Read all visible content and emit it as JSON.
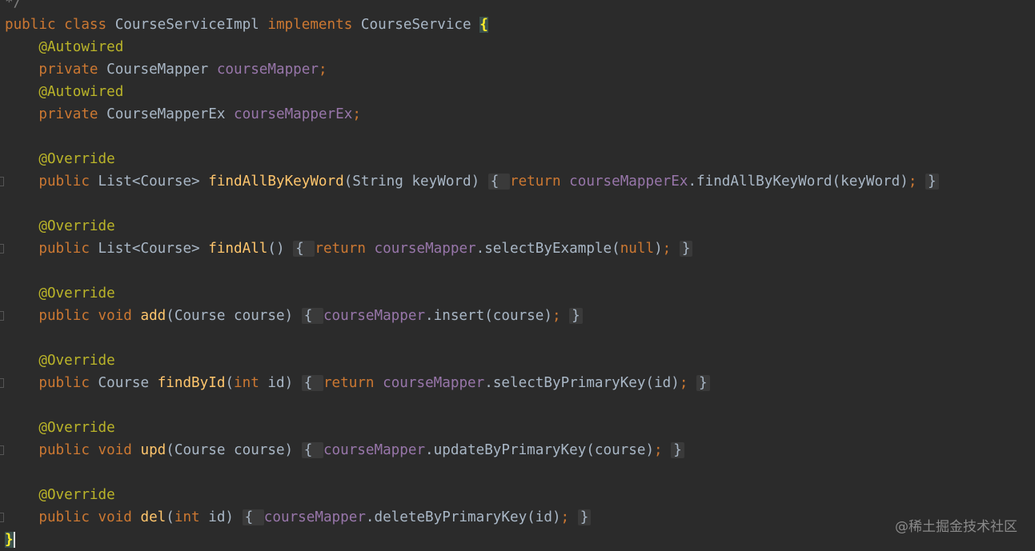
{
  "editor": {
    "theme_background": "#2b2b2b",
    "lines": [
      {
        "row": 0,
        "fold_gutter": false,
        "tokens": [
          {
            "t": "*/",
            "c": "c"
          }
        ]
      },
      {
        "row": 1,
        "fold_gutter": false,
        "tokens": [
          {
            "t": "public class ",
            "c": "k"
          },
          {
            "t": "CourseServiceImpl ",
            "c": "t"
          },
          {
            "t": "implements ",
            "c": "k"
          },
          {
            "t": "CourseService ",
            "c": "t"
          },
          {
            "t": "{",
            "c": "brace-hl"
          }
        ]
      },
      {
        "row": 2,
        "fold_gutter": false,
        "tokens": [
          {
            "t": "    ",
            "c": "t"
          },
          {
            "t": "@Autowired",
            "c": "a"
          }
        ]
      },
      {
        "row": 3,
        "fold_gutter": false,
        "tokens": [
          {
            "t": "    ",
            "c": "t"
          },
          {
            "t": "private ",
            "c": "k"
          },
          {
            "t": "CourseMapper ",
            "c": "t"
          },
          {
            "t": "courseMapper",
            "c": "f"
          },
          {
            "t": ";",
            "c": "s"
          }
        ]
      },
      {
        "row": 4,
        "fold_gutter": false,
        "tokens": [
          {
            "t": "    ",
            "c": "t"
          },
          {
            "t": "@Autowired",
            "c": "a"
          }
        ]
      },
      {
        "row": 5,
        "fold_gutter": false,
        "tokens": [
          {
            "t": "    ",
            "c": "t"
          },
          {
            "t": "private ",
            "c": "k"
          },
          {
            "t": "CourseMapperEx ",
            "c": "t"
          },
          {
            "t": "courseMapperEx",
            "c": "f"
          },
          {
            "t": ";",
            "c": "s"
          }
        ]
      },
      {
        "row": 7,
        "fold_gutter": false,
        "tokens": [
          {
            "t": "    ",
            "c": "t"
          },
          {
            "t": "@Override",
            "c": "a"
          }
        ]
      },
      {
        "row": 8,
        "fold_gutter": true,
        "tokens": [
          {
            "t": "    ",
            "c": "t"
          },
          {
            "t": "public ",
            "c": "k"
          },
          {
            "t": "List<Course> ",
            "c": "t"
          },
          {
            "t": "findAllByKeyWord",
            "c": "m"
          },
          {
            "t": "(String keyWord) ",
            "c": "t"
          },
          {
            "t": "{ ",
            "c": "fold"
          },
          {
            "t": "return ",
            "c": "k"
          },
          {
            "t": "courseMapperEx",
            "c": "f"
          },
          {
            "t": ".findAllByKeyWord(keyWord)",
            "c": "t"
          },
          {
            "t": ";",
            "c": "s"
          },
          {
            "t": " ",
            "c": "t"
          },
          {
            "t": "}",
            "c": "fold"
          }
        ]
      },
      {
        "row": 10,
        "fold_gutter": false,
        "tokens": [
          {
            "t": "    ",
            "c": "t"
          },
          {
            "t": "@Override",
            "c": "a"
          }
        ]
      },
      {
        "row": 11,
        "fold_gutter": true,
        "tokens": [
          {
            "t": "    ",
            "c": "t"
          },
          {
            "t": "public ",
            "c": "k"
          },
          {
            "t": "List<Course> ",
            "c": "t"
          },
          {
            "t": "findAll",
            "c": "m"
          },
          {
            "t": "() ",
            "c": "t"
          },
          {
            "t": "{ ",
            "c": "fold"
          },
          {
            "t": "return ",
            "c": "k"
          },
          {
            "t": "courseMapper",
            "c": "f"
          },
          {
            "t": ".selectByExample(",
            "c": "t"
          },
          {
            "t": "null",
            "c": "k"
          },
          {
            "t": ")",
            "c": "t"
          },
          {
            "t": ";",
            "c": "s"
          },
          {
            "t": " ",
            "c": "t"
          },
          {
            "t": "}",
            "c": "fold"
          }
        ]
      },
      {
        "row": 13,
        "fold_gutter": false,
        "tokens": [
          {
            "t": "    ",
            "c": "t"
          },
          {
            "t": "@Override",
            "c": "a"
          }
        ]
      },
      {
        "row": 14,
        "fold_gutter": true,
        "tokens": [
          {
            "t": "    ",
            "c": "t"
          },
          {
            "t": "public void ",
            "c": "k"
          },
          {
            "t": "add",
            "c": "m"
          },
          {
            "t": "(Course course) ",
            "c": "t"
          },
          {
            "t": "{ ",
            "c": "fold"
          },
          {
            "t": "courseMapper",
            "c": "f"
          },
          {
            "t": ".insert(course)",
            "c": "t"
          },
          {
            "t": ";",
            "c": "s"
          },
          {
            "t": " ",
            "c": "t"
          },
          {
            "t": "}",
            "c": "fold"
          }
        ]
      },
      {
        "row": 16,
        "fold_gutter": false,
        "tokens": [
          {
            "t": "    ",
            "c": "t"
          },
          {
            "t": "@Override",
            "c": "a"
          }
        ]
      },
      {
        "row": 17,
        "fold_gutter": true,
        "tokens": [
          {
            "t": "    ",
            "c": "t"
          },
          {
            "t": "public ",
            "c": "k"
          },
          {
            "t": "Course ",
            "c": "t"
          },
          {
            "t": "findById",
            "c": "m"
          },
          {
            "t": "(",
            "c": "t"
          },
          {
            "t": "int ",
            "c": "k"
          },
          {
            "t": "id) ",
            "c": "t"
          },
          {
            "t": "{ ",
            "c": "fold"
          },
          {
            "t": "return ",
            "c": "k"
          },
          {
            "t": "courseMapper",
            "c": "f"
          },
          {
            "t": ".selectByPrimaryKey(id)",
            "c": "t"
          },
          {
            "t": ";",
            "c": "s"
          },
          {
            "t": " ",
            "c": "t"
          },
          {
            "t": "}",
            "c": "fold"
          }
        ]
      },
      {
        "row": 19,
        "fold_gutter": false,
        "tokens": [
          {
            "t": "    ",
            "c": "t"
          },
          {
            "t": "@Override",
            "c": "a"
          }
        ]
      },
      {
        "row": 20,
        "fold_gutter": true,
        "tokens": [
          {
            "t": "    ",
            "c": "t"
          },
          {
            "t": "public void ",
            "c": "k"
          },
          {
            "t": "upd",
            "c": "m"
          },
          {
            "t": "(Course course) ",
            "c": "t"
          },
          {
            "t": "{ ",
            "c": "fold"
          },
          {
            "t": "courseMapper",
            "c": "f"
          },
          {
            "t": ".updateByPrimaryKey(course)",
            "c": "t"
          },
          {
            "t": ";",
            "c": "s"
          },
          {
            "t": " ",
            "c": "t"
          },
          {
            "t": "}",
            "c": "fold"
          }
        ]
      },
      {
        "row": 22,
        "fold_gutter": false,
        "tokens": [
          {
            "t": "    ",
            "c": "t"
          },
          {
            "t": "@Override",
            "c": "a"
          }
        ]
      },
      {
        "row": 23,
        "fold_gutter": true,
        "tokens": [
          {
            "t": "    ",
            "c": "t"
          },
          {
            "t": "public void ",
            "c": "k"
          },
          {
            "t": "del",
            "c": "m"
          },
          {
            "t": "(",
            "c": "t"
          },
          {
            "t": "int ",
            "c": "k"
          },
          {
            "t": "id) ",
            "c": "t"
          },
          {
            "t": "{ ",
            "c": "fold"
          },
          {
            "t": "courseMapper",
            "c": "f"
          },
          {
            "t": ".deleteByPrimaryKey(id)",
            "c": "t"
          },
          {
            "t": ";",
            "c": "s"
          },
          {
            "t": " ",
            "c": "t"
          },
          {
            "t": "}",
            "c": "fold"
          }
        ]
      },
      {
        "row": 24,
        "fold_gutter": false,
        "tokens": [
          {
            "t": "}",
            "c": "caret-brace"
          }
        ]
      }
    ]
  },
  "watermark": {
    "text": "@稀土掘金技术社区"
  },
  "colors": {
    "keyword": "#cc7832",
    "annotation": "#bbb529",
    "field": "#9876aa",
    "method": "#ffc66d",
    "text": "#a9b7c6",
    "brace_highlight": "#ffef28"
  }
}
